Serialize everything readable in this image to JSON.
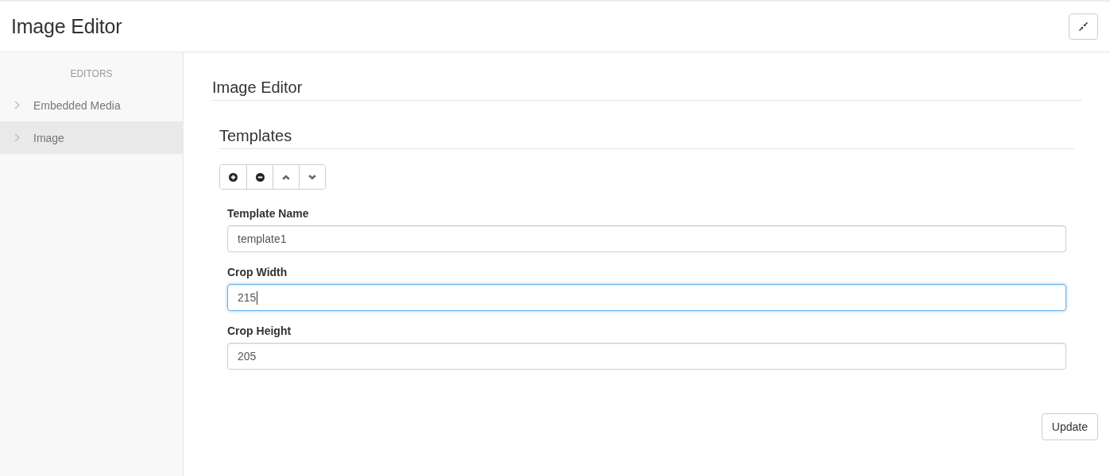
{
  "header": {
    "title": "Image Editor"
  },
  "sidebar": {
    "heading": "EDITORS",
    "items": [
      {
        "label": "Embedded Media",
        "selected": false
      },
      {
        "label": "Image",
        "selected": true
      }
    ]
  },
  "main": {
    "title": "Image Editor",
    "section": {
      "title": "Templates",
      "fields": [
        {
          "label": "Template Name",
          "value": "template1",
          "focused": false
        },
        {
          "label": "Crop Width",
          "value": "215",
          "focused": true
        },
        {
          "label": "Crop Height",
          "value": "205",
          "focused": false
        }
      ]
    },
    "buttons": [
      "Update"
    ]
  }
}
